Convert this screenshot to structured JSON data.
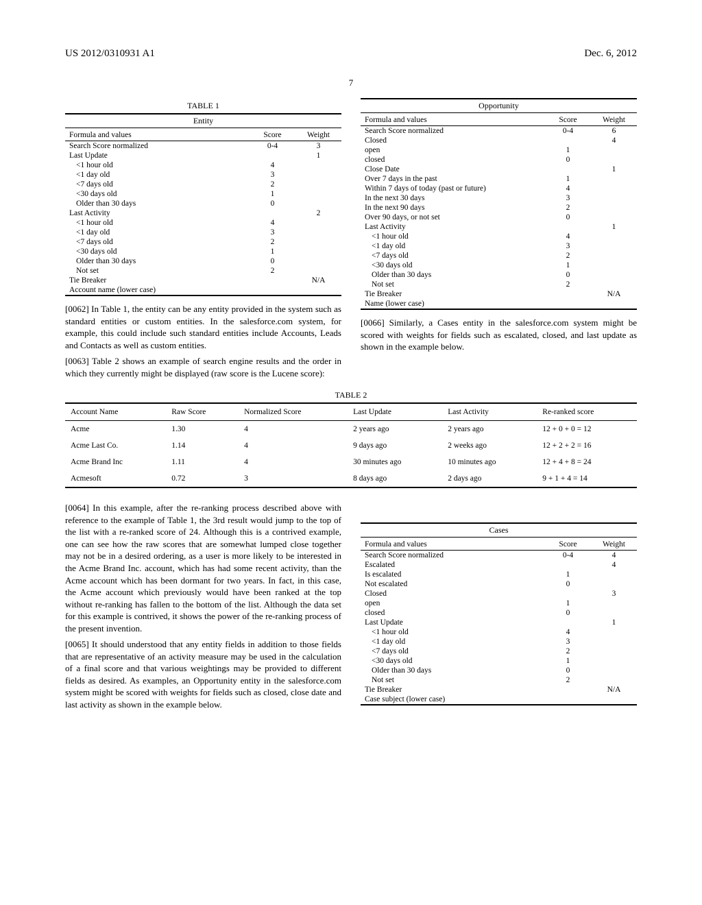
{
  "header": {
    "pub_no": "US 2012/0310931 A1",
    "date": "Dec. 6, 2012"
  },
  "page_number": "7",
  "table1": {
    "caption": "TABLE 1",
    "title": "Entity",
    "head": {
      "c0": "Formula and values",
      "c1": "Score",
      "c2": "Weight"
    },
    "rows": [
      {
        "label": "Search Score normalized",
        "score": "0-4",
        "weight": "3",
        "indent": 0
      },
      {
        "label": "Last Update",
        "score": "",
        "weight": "1",
        "indent": 0
      },
      {
        "label": "<1 hour old",
        "score": "4",
        "weight": "",
        "indent": 1
      },
      {
        "label": "<1 day old",
        "score": "3",
        "weight": "",
        "indent": 1
      },
      {
        "label": "<7 days old",
        "score": "2",
        "weight": "",
        "indent": 1
      },
      {
        "label": "<30 days old",
        "score": "1",
        "weight": "",
        "indent": 1
      },
      {
        "label": "Older than 30 days",
        "score": "0",
        "weight": "",
        "indent": 1
      },
      {
        "label": "Last Activity",
        "score": "",
        "weight": "2",
        "indent": 0
      },
      {
        "label": "<1 hour old",
        "score": "4",
        "weight": "",
        "indent": 1
      },
      {
        "label": "<1 day old",
        "score": "3",
        "weight": "",
        "indent": 1
      },
      {
        "label": "<7 days old",
        "score": "2",
        "weight": "",
        "indent": 1
      },
      {
        "label": "<30 days old",
        "score": "1",
        "weight": "",
        "indent": 1
      },
      {
        "label": "Older than 30 days",
        "score": "0",
        "weight": "",
        "indent": 1
      },
      {
        "label": "Not set",
        "score": "2",
        "weight": "",
        "indent": 1
      },
      {
        "label": "Tie Breaker",
        "score": "",
        "weight": "N/A",
        "indent": 0
      },
      {
        "label": "Account name (lower case)",
        "score": "",
        "weight": "",
        "indent": 0
      }
    ]
  },
  "para62": {
    "label": "[0062]",
    "text": "   In Table 1, the entity can be any entity provided in the system such as standard entities or custom entities. In the salesforce.com system, for example, this could include such standard entities include Accounts, Leads and Contacts as well as custom entities."
  },
  "para63": {
    "label": "[0063]",
    "text": "   Table 2 shows an example of search engine results and the order in which they currently might be displayed (raw score is the Lucene score):"
  },
  "table_opp": {
    "title": "Opportunity",
    "head": {
      "c0": "Formula and values",
      "c1": "Score",
      "c2": "Weight"
    },
    "rows": [
      {
        "label": "Search Score normalized",
        "score": "0-4",
        "weight": "6",
        "indent": 0
      },
      {
        "label": "Closed",
        "score": "",
        "weight": "4",
        "indent": 0
      },
      {
        "label": "open",
        "score": "1",
        "weight": "",
        "indent": 0
      },
      {
        "label": "closed",
        "score": "0",
        "weight": "",
        "indent": 0
      },
      {
        "label": "Close Date",
        "score": "",
        "weight": "1",
        "indent": 0
      },
      {
        "label": "Over 7 days in the past",
        "score": "1",
        "weight": "",
        "indent": 0
      },
      {
        "label": "Within 7 days of today (past or future)",
        "score": "4",
        "weight": "",
        "indent": 0
      },
      {
        "label": "In the next 30 days",
        "score": "3",
        "weight": "",
        "indent": 0
      },
      {
        "label": "In the next 90 days",
        "score": "2",
        "weight": "",
        "indent": 0
      },
      {
        "label": "Over 90 days, or not set",
        "score": "0",
        "weight": "",
        "indent": 0
      },
      {
        "label": "Last Activity",
        "score": "",
        "weight": "1",
        "indent": 0
      },
      {
        "label": "<1 hour old",
        "score": "4",
        "weight": "",
        "indent": 1
      },
      {
        "label": "<1 day old",
        "score": "3",
        "weight": "",
        "indent": 1
      },
      {
        "label": "<7 days old",
        "score": "2",
        "weight": "",
        "indent": 1
      },
      {
        "label": "<30 days old",
        "score": "1",
        "weight": "",
        "indent": 1
      },
      {
        "label": "Older than 30 days",
        "score": "0",
        "weight": "",
        "indent": 1
      },
      {
        "label": "Not set",
        "score": "2",
        "weight": "",
        "indent": 1
      },
      {
        "label": "Tie Breaker",
        "score": "",
        "weight": "N/A",
        "indent": 0
      },
      {
        "label": "Name (lower case)",
        "score": "",
        "weight": "",
        "indent": 0
      }
    ]
  },
  "para66": {
    "label": "[0066]",
    "text": "   Similarly, a Cases entity in the salesforce.com system might be scored with weights for fields such as escalated, closed, and last update as shown in the example below."
  },
  "table2": {
    "caption": "TABLE 2",
    "head": [
      "Account Name",
      "Raw Score",
      "Normalized Score",
      "Last Update",
      "Last Activity",
      "Re-ranked score"
    ],
    "rows": [
      [
        "Acme",
        "1.30",
        "4",
        "2 years ago",
        "2 years ago",
        "12 + 0 + 0 = 12"
      ],
      [
        "Acme Last Co.",
        "1.14",
        "4",
        "9 days ago",
        "2 weeks ago",
        "12 + 2 + 2 = 16"
      ],
      [
        "Acme Brand Inc",
        "1.11",
        "4",
        "30 minutes ago",
        "10 minutes ago",
        "12 + 4 + 8 = 24"
      ],
      [
        "Acmesoft",
        "0.72",
        "3",
        "8 days ago",
        "2 days ago",
        "9 + 1 + 4 = 14"
      ]
    ]
  },
  "para64": {
    "label": "[0064]",
    "text": "   In this example, after the re-ranking process described above with reference to the example of Table 1, the 3rd result would jump to the top of the list with a re-ranked score of 24. Although this is a contrived example, one can see how the raw scores that are somewhat lumped close together may not be in a desired ordering, as a user is more likely to be interested in the Acme Brand Inc. account, which has had some recent activity, than the Acme account which has been dormant for two years. In fact, in this case, the Acme account which previously would have been ranked at the top without re-ranking has fallen to the bottom of the list. Although the data set for this example is contrived, it shows the power of the re-ranking process of the present invention."
  },
  "para65": {
    "label": "[0065]",
    "text": "   It should understood that any entity fields in addition to those fields that are representative of an activity measure may be used in the calculation of a final score and that various weightings may be provided to different fields as desired. As examples, an Opportunity entity in the salesforce.com system might be scored with weights for fields such as closed, close date and last activity as shown in the example below."
  },
  "table_cases": {
    "title": "Cases",
    "head": {
      "c0": "Formula and values",
      "c1": "Score",
      "c2": "Weight"
    },
    "rows": [
      {
        "label": "Search Score normalized",
        "score": "0-4",
        "weight": "4",
        "indent": 0
      },
      {
        "label": "Escalated",
        "score": "",
        "weight": "4",
        "indent": 0
      },
      {
        "label": "Is escalated",
        "score": "1",
        "weight": "",
        "indent": 0
      },
      {
        "label": "Not escalated",
        "score": "0",
        "weight": "",
        "indent": 0
      },
      {
        "label": "Closed",
        "score": "",
        "weight": "3",
        "indent": 0
      },
      {
        "label": "open",
        "score": "1",
        "weight": "",
        "indent": 0
      },
      {
        "label": "closed",
        "score": "0",
        "weight": "",
        "indent": 0
      },
      {
        "label": "Last Update",
        "score": "",
        "weight": "1",
        "indent": 0
      },
      {
        "label": "<1 hour old",
        "score": "4",
        "weight": "",
        "indent": 1
      },
      {
        "label": "<1 day old",
        "score": "3",
        "weight": "",
        "indent": 1
      },
      {
        "label": "<7 days old",
        "score": "2",
        "weight": "",
        "indent": 1
      },
      {
        "label": "<30 days old",
        "score": "1",
        "weight": "",
        "indent": 1
      },
      {
        "label": "Older than 30 days",
        "score": "0",
        "weight": "",
        "indent": 1
      },
      {
        "label": "Not set",
        "score": "2",
        "weight": "",
        "indent": 1
      },
      {
        "label": "Tie Breaker",
        "score": "",
        "weight": "N/A",
        "indent": 0
      },
      {
        "label": "Case subject (lower case)",
        "score": "",
        "weight": "",
        "indent": 0
      }
    ]
  }
}
